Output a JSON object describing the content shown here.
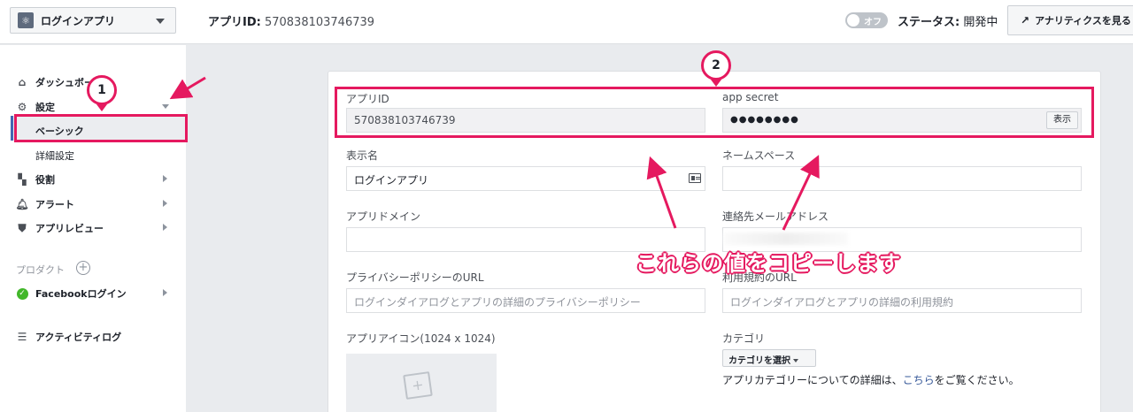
{
  "topbar": {
    "app_name": "ログインアプリ",
    "app_id_label": "アプリID:",
    "app_id_value": "570838103746739",
    "toggle_label": "オフ",
    "status_label": "ステータス:",
    "status_value": "開発中",
    "analytics_label": "アナリティクスを見る"
  },
  "sidebar": {
    "dashboard": "ダッシュボード",
    "settings": "設定",
    "basic": "ベーシック",
    "advanced": "詳細設定",
    "roles": "役割",
    "alerts": "アラート",
    "app_review": "アプリレビュー",
    "products_label": "プロダクト",
    "facebook_login": "Facebookログイン",
    "activity_log": "アクティビティログ"
  },
  "form": {
    "app_id_label": "アプリID",
    "app_id_value": "570838103746739",
    "app_secret_label": "app secret",
    "app_secret_value": "●●●●●●●●",
    "show_label": "表示",
    "display_name_label": "表示名",
    "display_name_value": "ログインアプリ",
    "namespace_label": "ネームスペース",
    "namespace_value": "",
    "app_domain_label": "アプリドメイン",
    "app_domain_value": "",
    "contact_email_label": "連絡先メールアドレス",
    "privacy_url_label": "プライバシーポリシーのURL",
    "privacy_url_placeholder": "ログインダイアログとアプリの詳細のプライバシーポリシー",
    "terms_url_label": "利用規約のURL",
    "terms_url_placeholder": "ログインダイアログとアプリの詳細の利用規約",
    "app_icon_label": "アプリアイコン(1024 x 1024)",
    "category_label": "カテゴリ",
    "category_button": "カテゴリを選択",
    "category_desc_prefix": "アプリカテゴリーについての詳細は、",
    "category_desc_link": "こちら",
    "category_desc_suffix": "をご覧ください。"
  },
  "annotations": {
    "badge1": "1",
    "badge2": "2",
    "copy_note": "これらの値をコピーします",
    "accent_color": "#e5195f"
  }
}
